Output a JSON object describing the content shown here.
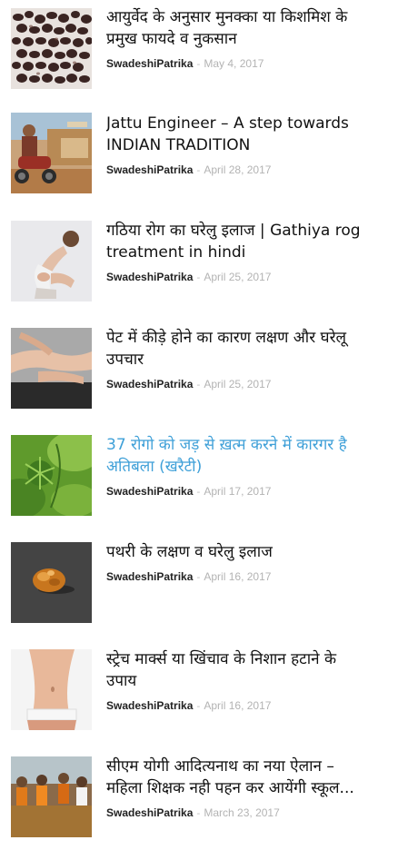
{
  "articles": [
    {
      "title_lines": [
        "आयुर्वेद के अनुसार मुनक्का या किशमिश के",
        "प्रमुख फायदे व नुकसान"
      ],
      "author": "SwadeshiPatrika",
      "separator": "-",
      "date": "May 4, 2017",
      "thumbnail": "raisins-image"
    },
    {
      "title_lines": [
        "Jattu Engineer – A step towards",
        "INDIAN TRADITION"
      ],
      "author": "SwadeshiPatrika",
      "separator": "-",
      "date": "April 28, 2017",
      "thumbnail": "movie-poster-image"
    },
    {
      "title_lines": [
        "गठिया रोग का घरेलु इलाज | Gathiya rog",
        "treatment in hindi"
      ],
      "author": "SwadeshiPatrika",
      "separator": "-",
      "date": "April 25, 2017",
      "thumbnail": "knee-pain-image"
    },
    {
      "title_lines": [
        "पेट में कीड़े होने का कारण लक्षण और घरेलू",
        "उपचार"
      ],
      "author": "SwadeshiPatrika",
      "separator": "-",
      "date": "April 25, 2017",
      "thumbnail": "stomach-ache-image"
    },
    {
      "title_lines": [
        "37 रोगो को जड़ से ख़त्म करने में कारगर है",
        "अतिबला (खरैटी)"
      ],
      "author": "SwadeshiPatrika",
      "separator": "-",
      "date": "April 17, 2017",
      "thumbnail": "atibala-plant-image",
      "highlighted": true,
      "highlight_color": "#3fa0d8"
    },
    {
      "title_lines": [
        "पथरी के लक्षण व घरेलु इलाज"
      ],
      "author": "SwadeshiPatrika",
      "separator": "-",
      "date": "April 16, 2017",
      "thumbnail": "kidney-stone-image"
    },
    {
      "title_lines": [
        "स्ट्रेच मार्क्स या खिंचाव के निशान हटाने के",
        "उपाय"
      ],
      "author": "SwadeshiPatrika",
      "separator": "-",
      "date": "April 16, 2017",
      "thumbnail": "waist-image"
    },
    {
      "title_lines": [
        "सीएम योगी आदित्यनाथ का नया ऐलान –",
        "महिला शिक्षक नही पहन कर आयेंगी स्कूल..."
      ],
      "author": "SwadeshiPatrika",
      "separator": "-",
      "date": "March 23, 2017",
      "thumbnail": "crowd-image"
    }
  ],
  "colors": {
    "title": "#111111",
    "highlight": "#3fa0d8",
    "author": "#222222",
    "date": "#b3b3b3"
  }
}
